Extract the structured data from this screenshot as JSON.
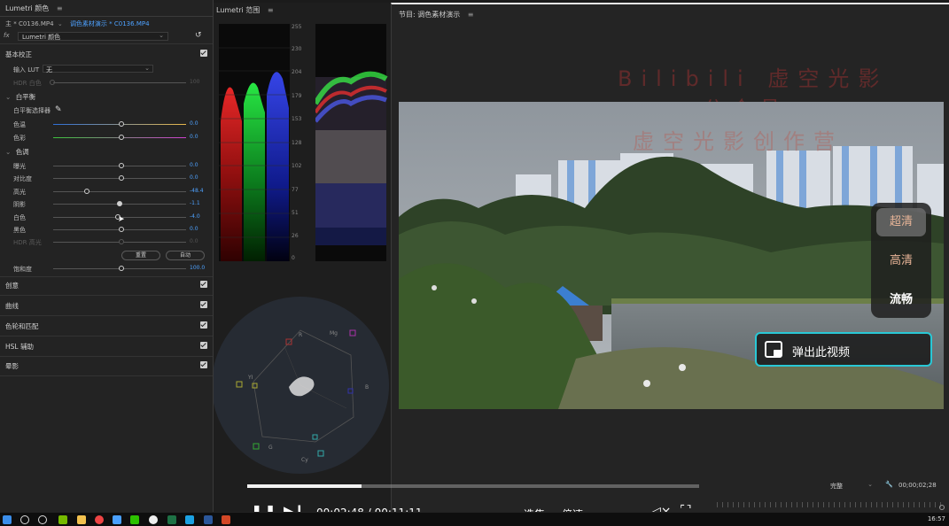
{
  "lumetri": {
    "title": "Lumetri 颜色",
    "menu": "≡",
    "master_clip": "主 * C0136.MP4",
    "sequence_clip": "调色素材演示 * C0136.MP4",
    "fx_label": "fx",
    "effect_name": "Lumetri 颜色",
    "basic_correction": "基本校正",
    "input_lut_label": "输入 LUT",
    "input_lut_value": "无",
    "hdr_white_label": "HDR 白色",
    "hdr_white_value": "100",
    "white_balance_header": "白平衡",
    "wb_selector_label": "白平衡选择器",
    "temperature": {
      "label": "色温",
      "value": "0.0"
    },
    "tint": {
      "label": "色彩",
      "value": "0.0"
    },
    "tone_header": "色调",
    "exposure": {
      "label": "曝光",
      "value": "0.0"
    },
    "contrast": {
      "label": "对比度",
      "value": "0.0"
    },
    "highlights": {
      "label": "高光",
      "value": "-48.4"
    },
    "shadows": {
      "label": "阴影",
      "value": "-1.1"
    },
    "whites": {
      "label": "白色",
      "value": "-4.0"
    },
    "blacks": {
      "label": "黑色",
      "value": "0.0"
    },
    "hdr_specular": {
      "label": "HDR 高光",
      "value": "0.0"
    },
    "reset_button": "重置",
    "auto_button": "自动",
    "saturation": {
      "label": "饱和度",
      "value": "100.0"
    },
    "sections": [
      "创意",
      "曲线",
      "色轮和匹配",
      "HSL 辅助",
      "晕影"
    ]
  },
  "scopes": {
    "title": "Lumetri 范围",
    "menu": "≡",
    "parade_scale": [
      "255",
      "230",
      "204",
      "179",
      "153",
      "128",
      "102",
      "77",
      "51",
      "26",
      "0"
    ],
    "vector_labels": [
      "R",
      "Mg",
      "YI",
      "B",
      "G",
      "Cy"
    ]
  },
  "program": {
    "title": "节目: 调色素材演示",
    "menu": "≡",
    "watermark_line1": "Bilibili 虚空光影",
    "watermark_line2": "公众号",
    "watermark_line3": "虚空光影创作营",
    "fit_select": "完整",
    "timecode": "00;00;02;28"
  },
  "quality_menu": {
    "items": [
      "超清",
      "高清",
      "流畅"
    ]
  },
  "popout_label": "弹出此视频",
  "player": {
    "current_time": "00:02:48",
    "separator": "/",
    "total_time": "00:11:11",
    "progress_fraction": 0.252,
    "episodes_label": "选集",
    "speed_label": "倍速"
  },
  "taskbar": {
    "clock": "16:57"
  },
  "colors": {
    "accent_blue": "#4ea2ff",
    "popout_border": "#29c8d6",
    "quality_text": "#e7b497"
  }
}
